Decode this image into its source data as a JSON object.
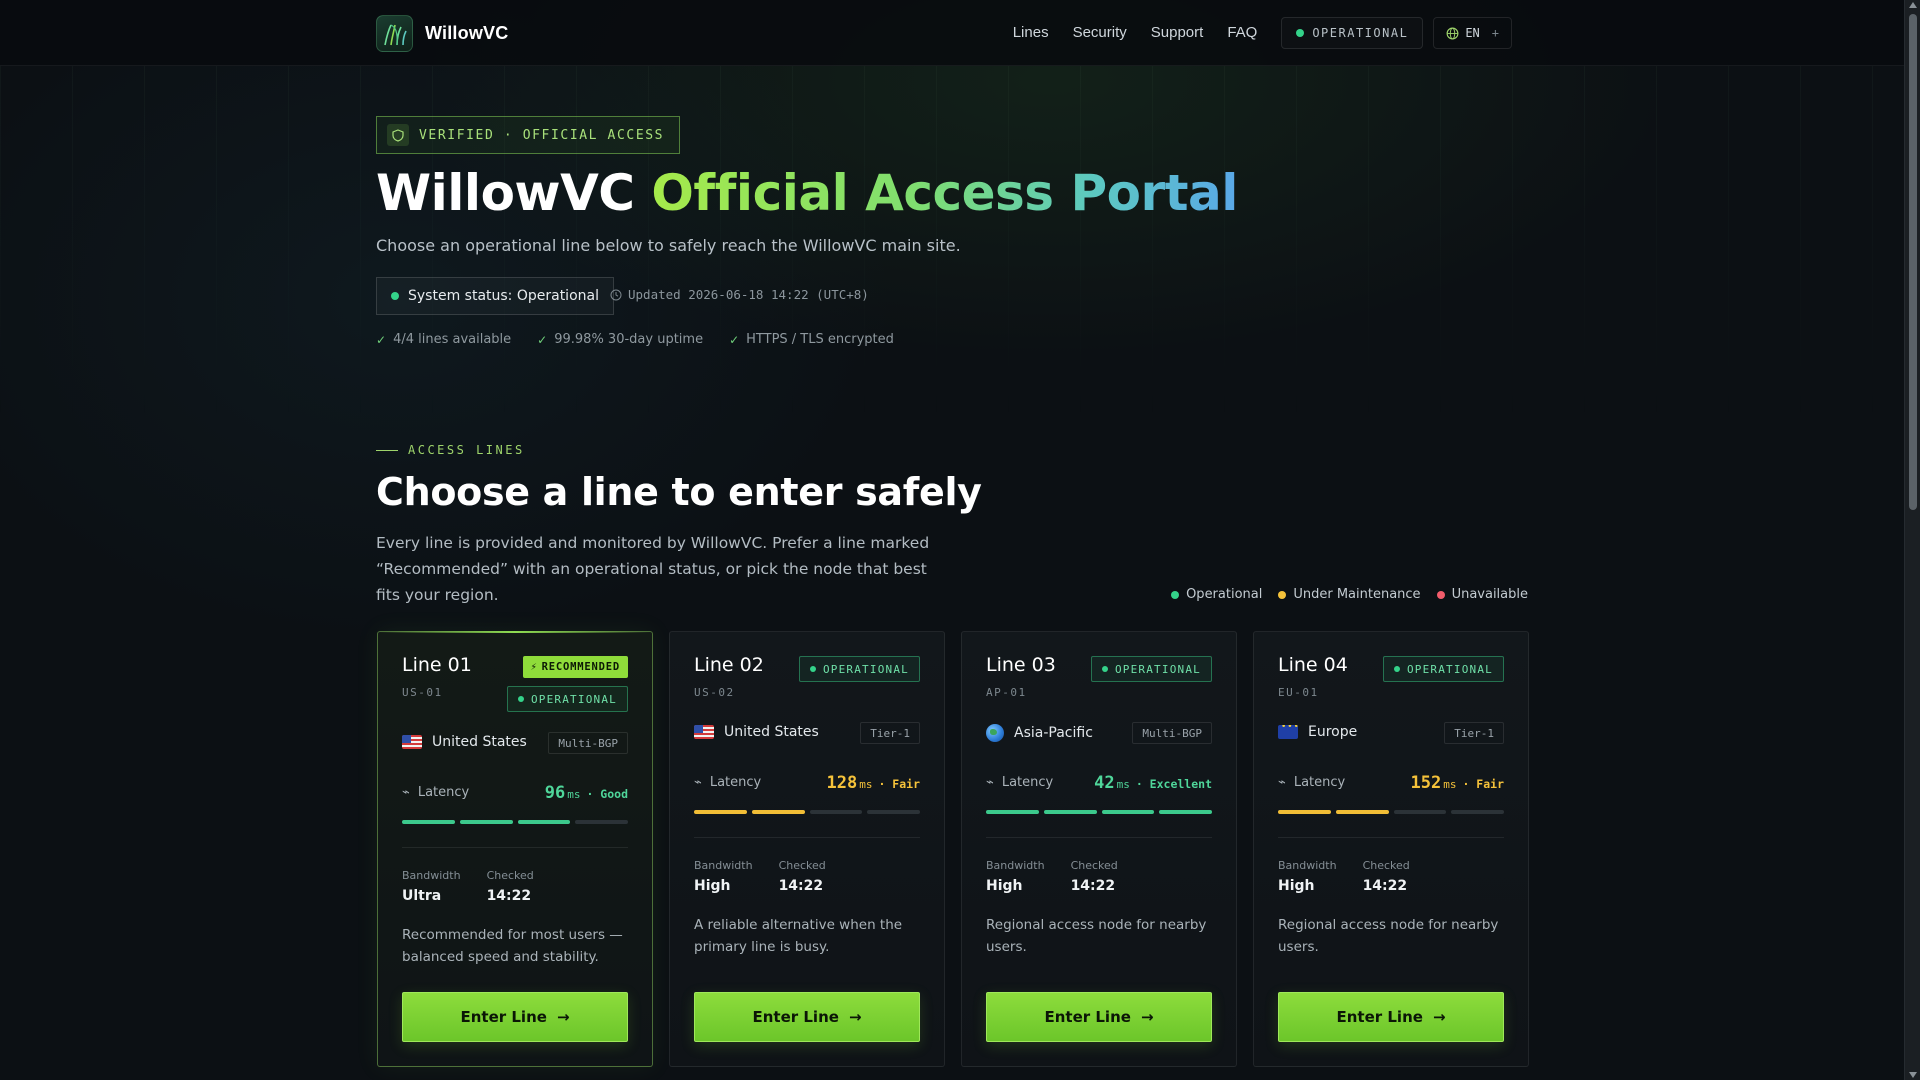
{
  "header": {
    "brand": "WillowVC",
    "nav": [
      "Lines",
      "Security",
      "Support",
      "FAQ"
    ],
    "status_label": "OPERATIONAL",
    "lang_label": "EN",
    "lang_plus": "+"
  },
  "hero": {
    "verified_label": "VERIFIED · OFFICIAL ACCESS",
    "title_main": "WillowVC ",
    "title_accent": "Official Access Portal",
    "subtitle": "Choose an operational line below to safely reach the WillowVC main site.",
    "system_status": "System status: Operational",
    "updated": "Updated 2026-06-18 14:22 (UTC+8)",
    "facts": [
      "4/4 lines available",
      "99.98% 30-day uptime",
      "HTTPS / TLS encrypted"
    ]
  },
  "section": {
    "eyebrow": "ACCESS LINES",
    "title": "Choose a line to enter safely",
    "description": "Every line is provided and monitored by WillowVC. Prefer a line marked “Recommended” with an operational status, or pick the node that best fits your region.",
    "legend": [
      {
        "label": "Operational",
        "color": "#34d38a"
      },
      {
        "label": "Under Maintenance",
        "color": "#f5c23a"
      },
      {
        "label": "Unavailable",
        "color": "#f25c6b"
      }
    ]
  },
  "lines": [
    {
      "name": "Line 01",
      "code": "US-01",
      "recommended": true,
      "recommended_label": "RECOMMENDED",
      "status": "OPERATIONAL",
      "region": "United States",
      "flag": "us-flag-icon",
      "tag": "Multi-BGP",
      "latency_label": "Latency",
      "latency": "96",
      "latency_unit": "ms",
      "quality": "· Good",
      "quality_color": "green",
      "signal_level": 3,
      "signal_max": 4,
      "bandwidth_label": "Bandwidth",
      "bandwidth": "Ultra",
      "checked_label": "Checked",
      "checked": "14:22",
      "description": "Recommended for most users — balanced speed and stability.",
      "button": "Enter Line"
    },
    {
      "name": "Line 02",
      "code": "US-02",
      "recommended": false,
      "status": "OPERATIONAL",
      "region": "United States",
      "flag": "us-flag-icon",
      "tag": "Tier-1",
      "latency_label": "Latency",
      "latency": "128",
      "latency_unit": "ms",
      "quality": "· Fair",
      "quality_color": "yellow",
      "signal_level": 2,
      "signal_max": 4,
      "bandwidth_label": "Bandwidth",
      "bandwidth": "High",
      "checked_label": "Checked",
      "checked": "14:22",
      "description": "A reliable alternative when the primary line is busy.",
      "button": "Enter Line"
    },
    {
      "name": "Line 03",
      "code": "AP-01",
      "recommended": false,
      "status": "OPERATIONAL",
      "region": "Asia-Pacific",
      "flag": "globe-icon",
      "tag": "Multi-BGP",
      "latency_label": "Latency",
      "latency": "42",
      "latency_unit": "ms",
      "quality": "· Excellent",
      "quality_color": "green",
      "signal_level": 4,
      "signal_max": 4,
      "bandwidth_label": "Bandwidth",
      "bandwidth": "High",
      "checked_label": "Checked",
      "checked": "14:22",
      "description": "Regional access node for nearby users.",
      "button": "Enter Line"
    },
    {
      "name": "Line 04",
      "code": "EU-01",
      "recommended": false,
      "status": "OPERATIONAL",
      "region": "Europe",
      "flag": "eu-flag-icon",
      "tag": "Tier-1",
      "latency_label": "Latency",
      "latency": "152",
      "latency_unit": "ms",
      "quality": "· Fair",
      "quality_color": "yellow",
      "signal_level": 2,
      "signal_max": 4,
      "bandwidth_label": "Bandwidth",
      "bandwidth": "High",
      "checked_label": "Checked",
      "checked": "14:22",
      "description": "Regional access node for nearby users.",
      "button": "Enter Line"
    }
  ]
}
